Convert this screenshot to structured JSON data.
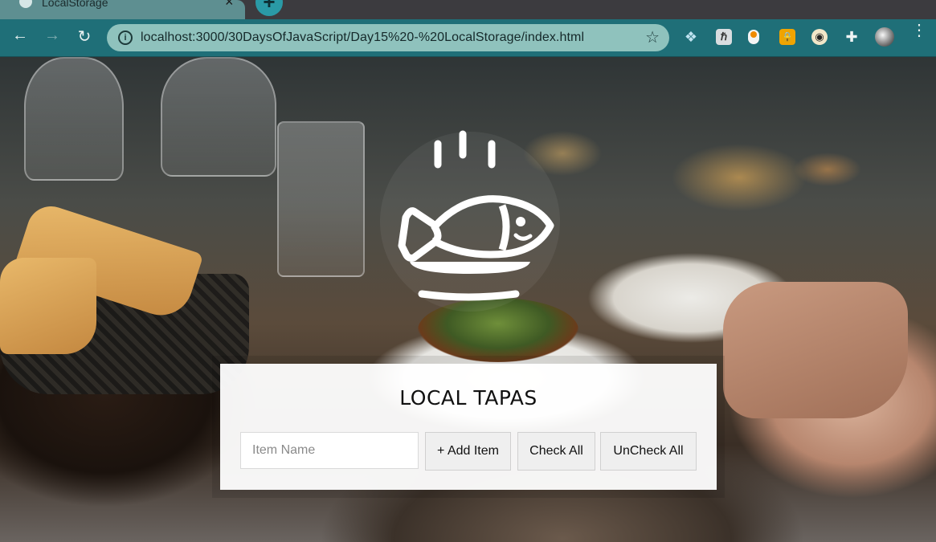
{
  "browser": {
    "tab_title": "LocalStorage",
    "tab_close": "×",
    "new_tab": "+",
    "url": "localhost:3000/30DaysOfJavaScript/Day15%20-%20LocalStorage/index.html",
    "back": "←",
    "forward": "→",
    "reload": "↻",
    "info": "i",
    "bookmark": "☆"
  },
  "extensions": [
    "dropbox-icon",
    "h-extension-icon",
    "toggle-extension-icon",
    "lock-extension-icon",
    "spy-extension-icon",
    "puzzle-icon",
    "avatar"
  ],
  "app": {
    "title": "LOCAL TAPAS",
    "item_placeholder": "Item Name",
    "add_item_label": "+ Add Item",
    "check_all_label": "Check All",
    "uncheck_all_label": "UnCheck All"
  },
  "colors": {
    "toolbar": "#1f6f78",
    "omnibox": "#8fc2bd",
    "card": "#ffffff",
    "button": "#efefef"
  }
}
